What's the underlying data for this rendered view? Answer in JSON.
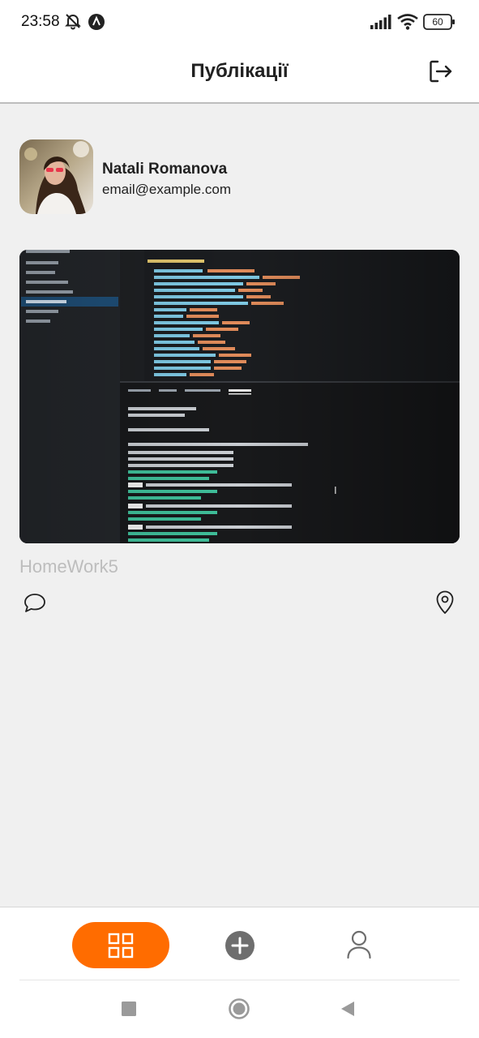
{
  "status_bar": {
    "time": "23:58",
    "battery": "60",
    "icons": [
      "muted-bell-icon",
      "app-notification-icon",
      "signal-icon",
      "wifi-icon",
      "battery-icon"
    ]
  },
  "header": {
    "title": "Публікації",
    "logout_icon": "log-out-icon"
  },
  "profile": {
    "name": "Natali Romanova",
    "email": "email@example.com"
  },
  "post": {
    "title": "HomeWork5",
    "comment_icon": "message-circle-icon",
    "location_icon": "map-pin-icon"
  },
  "tab_bar": {
    "items": [
      {
        "icon": "grid-icon",
        "active": true
      },
      {
        "icon": "plus-circle-icon",
        "active": false
      },
      {
        "icon": "user-icon",
        "active": false
      }
    ]
  },
  "system_nav": {
    "icons": [
      "recents-square-icon",
      "home-circle-icon",
      "back-triangle-icon"
    ]
  },
  "colors": {
    "accent": "#FF6C00",
    "muted_text": "#BDBDBD",
    "background": "#F0F0F0"
  }
}
